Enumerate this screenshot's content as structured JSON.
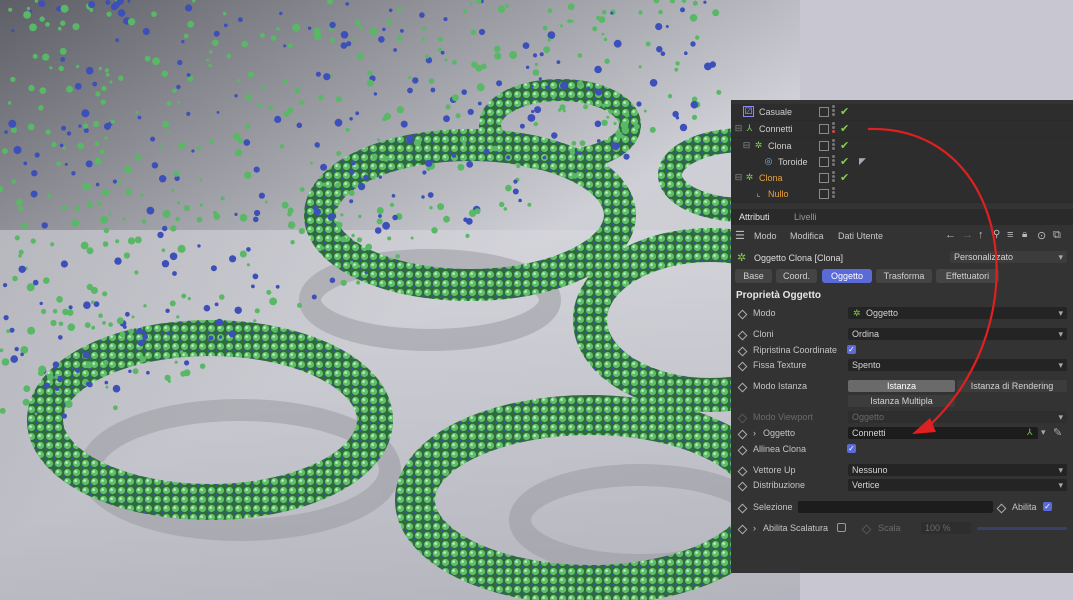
{
  "object_manager": {
    "rows": [
      {
        "label": "Casuale",
        "icon": "random-effector-icon",
        "selected": false
      },
      {
        "label": "Connetti",
        "icon": "connect-object-icon",
        "selected": false
      },
      {
        "label": "Clona",
        "icon": "cloner-icon",
        "selected": false
      },
      {
        "label": "Toroide",
        "icon": "torus-icon",
        "selected": false
      },
      {
        "label": "Clona",
        "icon": "cloner-icon",
        "selected": true
      },
      {
        "label": "Nullo",
        "icon": "null-object-icon",
        "selected": true
      }
    ]
  },
  "tabs": {
    "attributi": "Attributi",
    "livelli": "Livelli"
  },
  "menu": {
    "modo": "Modo",
    "modifica": "Modifica",
    "dati_utente": "Dati Utente"
  },
  "object_header": {
    "title": "Oggetto Clona [Clona]",
    "preset": "Personalizzato"
  },
  "subtabs": {
    "base": "Base",
    "coord": "Coord.",
    "oggetto": "Oggetto",
    "trasforma": "Trasforma",
    "effettuatori": "Effettuatori"
  },
  "section_title": "Proprietà Oggetto",
  "props": {
    "modo_label": "Modo",
    "modo_value": "Oggetto",
    "cloni_label": "Cloni",
    "cloni_value": "Ordina",
    "ripristina_label": "Ripristina Coordinate",
    "fissa_label": "Fissa Texture",
    "fissa_value": "Spento",
    "istanza_label": "Modo Istanza",
    "istanza_opt1": "Istanza",
    "istanza_opt2": "Istanza di Rendering",
    "istanza_opt3": "Istanza Multipla",
    "viewport_label": "Modo Viewport",
    "viewport_value": "Oggetto",
    "oggetto_label": "Oggetto",
    "oggetto_value": "Connetti",
    "allinea_label": "Allinea Clona",
    "vettore_label": "Vettore Up",
    "vettore_value": "Nessuno",
    "distribuzione_label": "Distribuzione",
    "distribuzione_value": "Vertice",
    "selezione_label": "Selezione",
    "abilita_label": "Abilita",
    "scalatura_label": "Abilita Scalatura",
    "scala_label": "Scala",
    "scala_value": "100 %"
  },
  "colors": {
    "accent": "#5a6bd8",
    "selected_text": "#e9a23b",
    "check": "#7fd04a",
    "arrow": "#e02020"
  }
}
